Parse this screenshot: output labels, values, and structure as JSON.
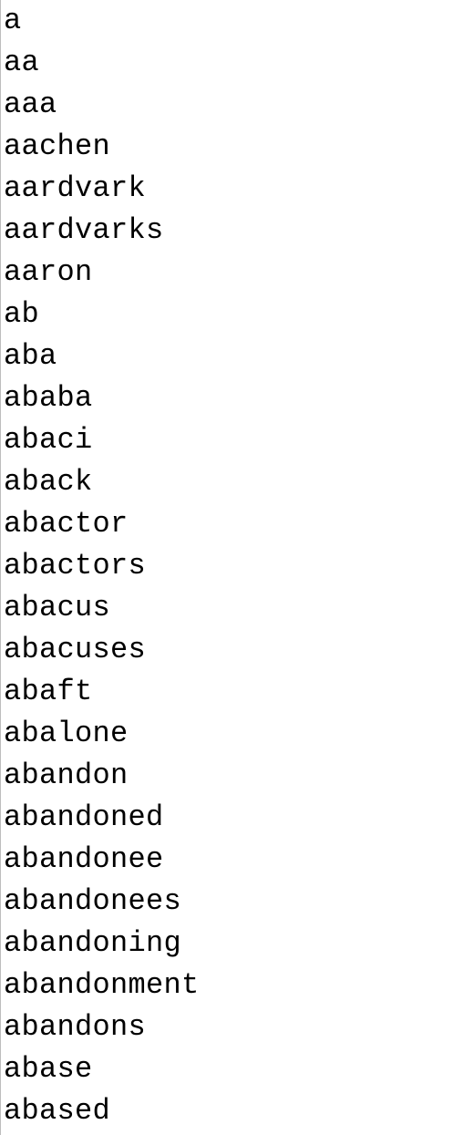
{
  "document": {
    "lines": [
      "a",
      "aa",
      "aaa",
      "aachen",
      "aardvark",
      "aardvarks",
      "aaron",
      "ab",
      "aba",
      "ababa",
      "abaci",
      "aback",
      "abactor",
      "abactors",
      "abacus",
      "abacuses",
      "abaft",
      "abalone",
      "abandon",
      "abandoned",
      "abandonee",
      "abandonees",
      "abandoning",
      "abandonment",
      "abandons",
      "abase",
      "abased"
    ]
  }
}
